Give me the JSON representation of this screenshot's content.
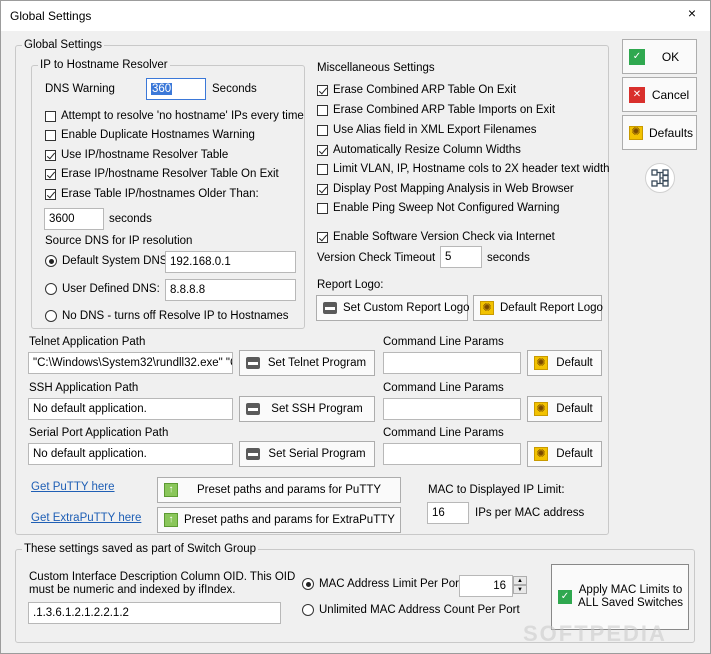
{
  "window": {
    "title": "Global Settings",
    "close_glyph": "×"
  },
  "groups": {
    "global": "Global Settings",
    "resolver": "IP to Hostname Resolver",
    "switch_group": "These settings saved as part of Switch Group"
  },
  "resolver": {
    "dns_warning_label": "DNS Warning",
    "dns_warning_value": "360",
    "seconds_label": "Seconds",
    "options": [
      {
        "label": "Attempt to resolve 'no hostname' IPs every time",
        "checked": false
      },
      {
        "label": "Enable Duplicate Hostnames Warning",
        "checked": false
      },
      {
        "label": "Use IP/hostname Resolver Table",
        "checked": true
      },
      {
        "label": "Erase IP/hostname Resolver Table On Exit",
        "checked": true
      },
      {
        "label": "Erase Table IP/hostnames Older Than:",
        "checked": true
      }
    ],
    "older_than_value": "3600",
    "older_than_unit": "seconds",
    "source_dns_label": "Source DNS for IP resolution",
    "default_dns_label": "Default System DNS:",
    "default_dns_value": "192.168.0.1",
    "user_dns_label": "User Defined DNS:",
    "user_dns_value": "8.8.8.8",
    "no_dns_label": "No DNS - turns off Resolve IP to Hostnames",
    "selected": "default"
  },
  "misc": {
    "title": "Miscellaneous Settings",
    "options": [
      {
        "label": "Erase Combined ARP Table On Exit",
        "checked": true
      },
      {
        "label": "Erase Combined ARP Table Imports on Exit",
        "checked": false
      },
      {
        "label": "Use Alias field in XML Export Filenames",
        "checked": false
      },
      {
        "label": "Automatically Resize Column Widths",
        "checked": true
      },
      {
        "label": "Limit VLAN, IP, Hostname cols to 2X header text width",
        "checked": false
      },
      {
        "label": "Display Post Mapping Analysis in Web Browser",
        "checked": true
      },
      {
        "label": "Enable Ping Sweep Not Configured Warning",
        "checked": false
      },
      {
        "label": "Enable Software Version Check via Internet",
        "checked": true
      }
    ],
    "version_timeout_label": "Version Check Timeout",
    "version_timeout_value": "5",
    "version_timeout_unit": "seconds",
    "report_logo_label": "Report Logo:",
    "set_custom_logo": "Set Custom Report Logo",
    "default_logo": "Default Report Logo"
  },
  "apps": {
    "command_line_label": "Command Line Params",
    "default_label": "Default",
    "telnet": {
      "label": "Telnet Application Path",
      "value": "\"C:\\Windows\\System32\\rundll32.exe\" \"C",
      "button": "Set Telnet Program",
      "params": ""
    },
    "ssh": {
      "label": "SSH Application Path",
      "value": "No default application.",
      "button": "Set SSH Program",
      "params": ""
    },
    "serial": {
      "label": "Serial Port Application Path",
      "value": "No default application.",
      "button": "Set Serial Program",
      "params": ""
    }
  },
  "putty": {
    "get_putty": "Get PuTTY here",
    "get_extraputty": "Get ExtraPuTTY here",
    "preset_putty": "Preset paths and params for PuTTY",
    "preset_extraputty": "Preset paths and params for ExtraPuTTY"
  },
  "mac": {
    "limit_label": "MAC to Displayed IP Limit:",
    "limit_value": "16",
    "limit_unit": "IPs per MAC address"
  },
  "switch_group": {
    "oid_label_1": "Custom Interface Description Column OID. This OID",
    "oid_label_2": "must be numeric and indexed by ifIndex.",
    "oid_value": ".1.3.6.1.2.1.2.2.1.2",
    "mac_limit_per_port": "MAC Address Limit Per Port",
    "mac_limit_value": "16",
    "unlimited": "Unlimited MAC Address Count Per Port",
    "selected": "limit",
    "apply_button_1": "Apply MAC Limits to",
    "apply_button_2": "ALL Saved Switches"
  },
  "side": {
    "ok": "OK",
    "cancel": "Cancel",
    "defaults": "Defaults"
  },
  "watermark": "SOFTPEDIA"
}
